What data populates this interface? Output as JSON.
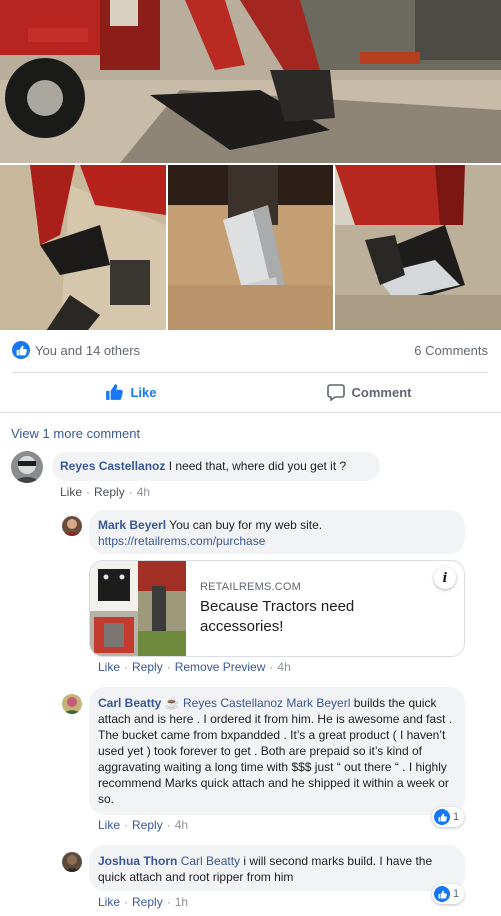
{
  "reactions": {
    "summary": "You and 14 others",
    "comments_count": "6 Comments"
  },
  "actions": {
    "like": "Like",
    "comment": "Comment"
  },
  "view_more": "View 1 more comment",
  "comments": [
    {
      "author": "Reyes Castellanoz",
      "text": "I need that, where did you get it ?",
      "actions": {
        "like": "Like",
        "reply": "Reply",
        "time": "4h"
      }
    },
    {
      "author": "Mark Beyerl",
      "text": "You can buy for my web site.",
      "link": "https://retailrems.com/purchase",
      "preview": {
        "domain": "RETAILREMS.COM",
        "title": "Because Tractors need accessories!",
        "info": "i"
      },
      "actions": {
        "like": "Like",
        "reply": "Reply",
        "remove": "Remove Preview",
        "time": "4h"
      }
    },
    {
      "author": "Carl Beatty",
      "badge": "☕",
      "mention": "Reyes Castellanoz Mark Beyerl",
      "text": " builds the quick attach and is here . I ordered it from him. He is awesome and fast . The bucket came from bxpandded . It’s a great product ( I haven’t used yet ) took forever to get . Both are prepaid so it’s kind of aggravating waiting a long time with $$$ just “ out there “ . I highly recommend Marks quick attach and he shipped it within a week or so.",
      "reaction_count": "1",
      "actions": {
        "like": "Like",
        "reply": "Reply",
        "time": "4h"
      }
    },
    {
      "author": "Joshua Thorn",
      "mention": "Carl Beatty",
      "text": " i will second marks build. I have the quick attach and root ripper from him",
      "reaction_count": "1",
      "actions": {
        "like": "Like",
        "reply": "Reply",
        "time": "1h"
      }
    }
  ],
  "colors": {
    "link_blue": "#385898",
    "fb_blue": "#1877f2",
    "bubble_gray": "#f2f3f5"
  }
}
